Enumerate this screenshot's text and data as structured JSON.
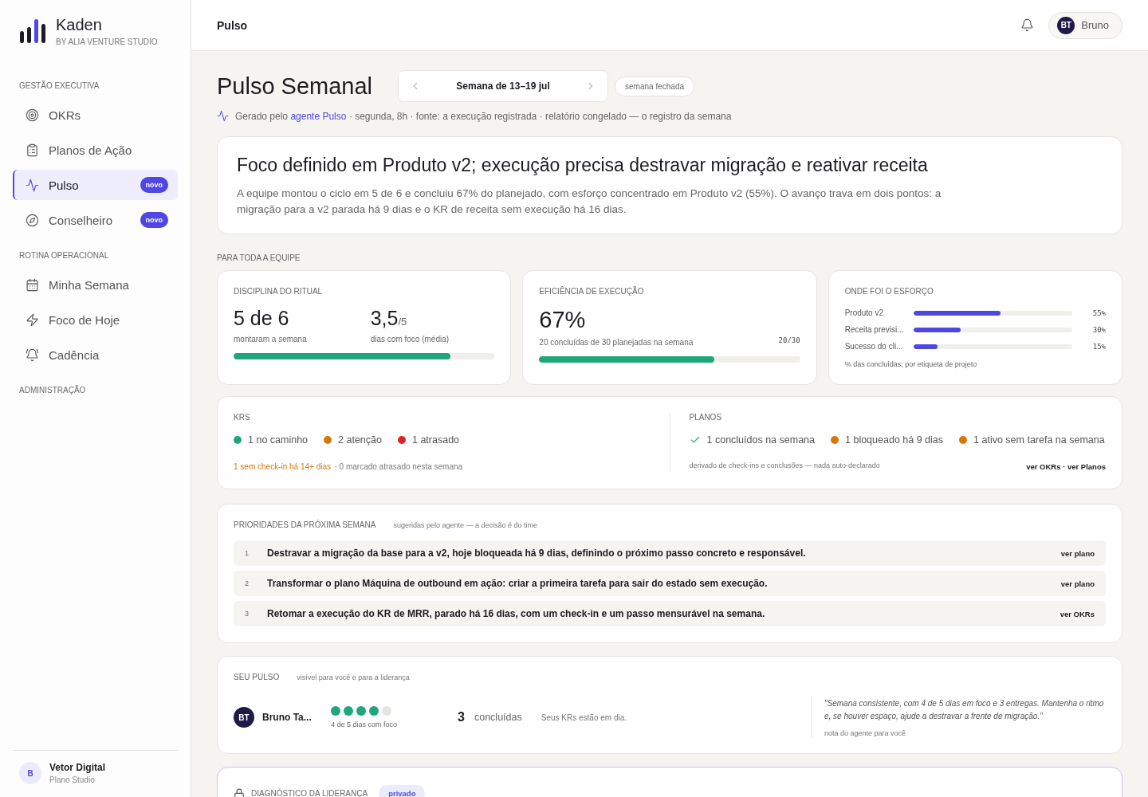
{
  "brand": {
    "name": "Kaden",
    "subtitle": "BY ALIA VENTURE STUDIO"
  },
  "sidebar": {
    "sections": [
      {
        "title": "GESTÃO EXECUTIVA",
        "items": [
          {
            "label": "OKRs",
            "selected": false
          },
          {
            "label": "Planos de Ação",
            "selected": false
          },
          {
            "label": "Pulso",
            "selected": true,
            "badge": "novo"
          },
          {
            "label": "Conselheiro",
            "selected": false,
            "badge": "novo"
          }
        ]
      },
      {
        "title": "ROTINA OPERACIONAL",
        "items": [
          {
            "label": "Minha Semana",
            "selected": false
          },
          {
            "label": "Foco de Hoje",
            "selected": false
          },
          {
            "label": "Cadência",
            "selected": false
          }
        ]
      },
      {
        "title": "ADMINISTRAÇÃO"
      }
    ],
    "workspace": {
      "initial": "B",
      "name": "Vetor Digital",
      "plan": "Plano Studio"
    }
  },
  "header": {
    "breadcrumb": "Pulso",
    "user": {
      "initials": "BT",
      "name": "Bruno"
    }
  },
  "page": {
    "title": "Pulso Semanal",
    "week": "Semana de 13–19 jul",
    "status": "semana fechada",
    "meta_prefix": "Gerado pelo",
    "meta_link": "agente Pulso",
    "meta_suffix": "· segunda, 8h · fonte: a execução registrada · relatório congelado — o registro da semana"
  },
  "summary": {
    "headline": "Foco definido em Produto v2; execução precisa destravar migração e reativar receita",
    "body": "A equipe montou o ciclo em 5 de 6 e concluiu 67% do planejado, com esforço concentrado em Produto v2 (55%). O avanço trava em dois pontos: a migração para a v2 parada há 9 dias e o KR de receita sem execução há 16 dias."
  },
  "team": {
    "title": "PARA TODA A EQUIPE",
    "ritual": {
      "title": "DISCIPLINA DO RITUAL",
      "value": "5 de 6",
      "value_caption": "montaram a semana",
      "focus": "3,5",
      "focus_of": "/5",
      "focus_caption": "dias com foco (média)",
      "level": 0.83
    },
    "efficiency": {
      "title": "EFICIÊNCIA DE EXECUÇÃO",
      "value": "67%",
      "caption": "20 concluídas de 30 planejadas na semana",
      "ratio": "20/30",
      "level": 0.67
    },
    "effort": {
      "title": "ONDE FOI O ESFORÇO",
      "rows": [
        {
          "label": "Produto v2",
          "reading": "55%",
          "level": 0.55
        },
        {
          "label": "Receita previsi...",
          "reading": "30%",
          "level": 0.3
        },
        {
          "label": "Sucesso do cli...",
          "reading": "15%",
          "level": 0.15
        }
      ],
      "caption": "% das concluídas, por etiqueta de projeto"
    }
  },
  "status": {
    "krs": {
      "title": "KRS",
      "items": [
        {
          "label": "1 no caminho",
          "kind": "dot",
          "color": "#1fa67a"
        },
        {
          "label": "2 atenção",
          "kind": "dot",
          "color": "#d97706"
        },
        {
          "label": "1 atrasado",
          "kind": "dot",
          "color": "#dc2626"
        }
      ],
      "warning": "1 sem check-in há 14+ dias",
      "note": "· 0 marcado atrasado nesta semana"
    },
    "plans": {
      "title": "PLANOS",
      "items": [
        {
          "label": "1 concluídos na semana",
          "kind": "check",
          "color": "#1fa67a"
        },
        {
          "label": "1 bloqueado há 9 dias",
          "kind": "dot",
          "color": "#d97706"
        },
        {
          "label": "1 ativo sem tarefa na semana",
          "kind": "dot",
          "color": "#d97706"
        }
      ],
      "note": "derivado de check-ins e conclusões — nada auto-declarado",
      "links": [
        "ver OKRs",
        "ver Planos"
      ],
      "link_separator": "·"
    }
  },
  "priorities": {
    "title": "PRIORIDADES DA PRÓXIMA SEMANA",
    "subtitle": "sugeridas pelo agente — a decisão é do time",
    "items": [
      {
        "number": "1",
        "text": "Destravar a migração da base para a v2, hoje bloqueada há 9 dias, definindo o próximo passo concreto e responsável.",
        "link": "ver plano"
      },
      {
        "number": "2",
        "text": "Transformar o plano Máquina de outbound em ação: criar a primeira tarefa para sair do estado sem execução.",
        "link": "ver plano"
      },
      {
        "number": "3",
        "text": "Retomar a execução do KR de MRR, parado há 16 dias, com um check-in e um passo mensurável na semana.",
        "link": "ver OKRs"
      }
    ]
  },
  "my_pulse": {
    "title": "SEU PULSO",
    "subtitle": "visível para você e para a liderança",
    "initials": "BT",
    "name": "Bruno Ta...",
    "stars": 4,
    "focus_caption": "4 de 5 dias com foco",
    "done": "3",
    "done_label": "concluídas",
    "krs_note": "Seus KRs estão em dia.",
    "quote": "\"Semana consistente, com 4 de 5 dias em foco e 3 entregas. Mantenha o ritmo e, se houver espaço, ajude a destravar a frente de migração.\"",
    "quote_caption": "nota do agente para você"
  },
  "leadership": {
    "title": "DIAGNÓSTICO DA LIDERANÇA",
    "badge": "privado"
  }
}
